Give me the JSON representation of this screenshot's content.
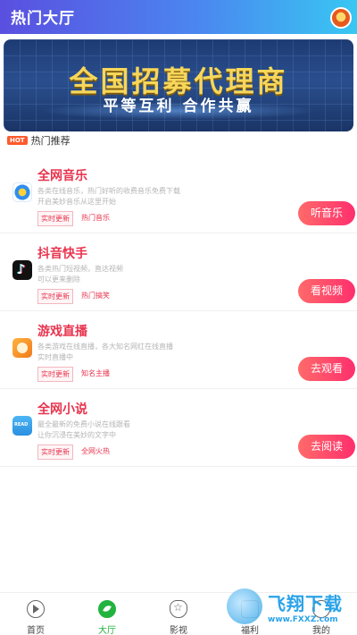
{
  "header": {
    "title": "热门大厅",
    "avatar_icon": "lion-avatar-icon"
  },
  "banner": {
    "title": "全国招募代理商",
    "subtitle": "平等互利  合作共赢"
  },
  "section": {
    "badge": "HOT",
    "title": "热门推荐"
  },
  "items": [
    {
      "title": "全网音乐",
      "desc1": "各类在线音乐，热门好听的收费音乐免费下载",
      "desc2": "开启美妙音乐从这里开始",
      "tag1": "实时更新",
      "tag2": "热门音乐",
      "button": "听音乐",
      "icon": "music-app-icon"
    },
    {
      "title": "抖音快手",
      "desc1": "各类热门短视频，直达视频",
      "desc2": "可以更来删除",
      "tag1": "实时更新",
      "tag2": "热门搞笑",
      "button": "看视频",
      "icon": "douyin-app-icon"
    },
    {
      "title": "游戏直播",
      "desc1": "各类游戏在线直播，各大知名网红在线直播",
      "desc2": "实时直播中",
      "tag1": "实时更新",
      "tag2": "知名主播",
      "button": "去观看",
      "icon": "game-app-icon"
    },
    {
      "title": "全网小说",
      "desc1": "最全最新的免费小说在线跟看",
      "desc2": "让你沉浸在美妙的文字中",
      "tag1": "实时更新",
      "tag2": "全网火热",
      "button": "去阅读",
      "icon": "novel-app-icon"
    }
  ],
  "tabs": [
    {
      "label": "首页",
      "icon": "play-icon"
    },
    {
      "label": "大厅",
      "icon": "leaf-icon",
      "active": true
    },
    {
      "label": "影视",
      "icon": "film-icon"
    },
    {
      "label": "福利",
      "icon": "gift-icon"
    },
    {
      "label": "我的",
      "icon": "user-icon"
    }
  ],
  "watermark": {
    "name": "飞翔下载",
    "url": "www.FXXZ.com"
  },
  "colors": {
    "header_start": "#5a4fe0",
    "header_end": "#38c7f2",
    "accent": "#e8344e",
    "active_tab": "#22b33f"
  }
}
